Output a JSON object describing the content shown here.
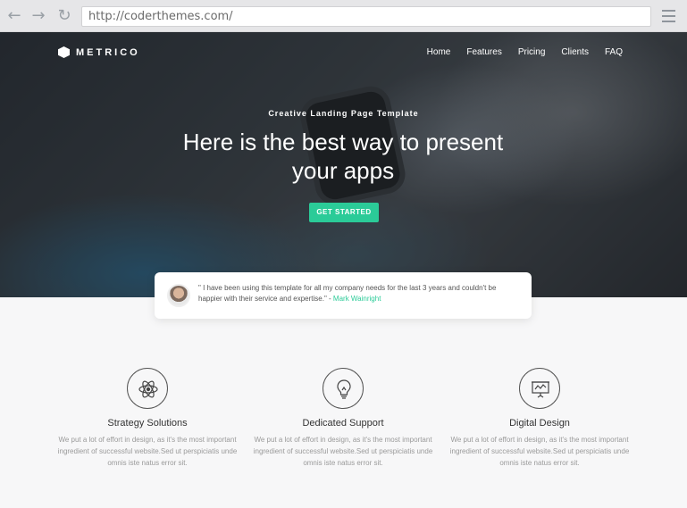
{
  "browser": {
    "url": "http://coderthemes.com/",
    "icons": [
      "back-arrow-icon",
      "forward-arrow-icon",
      "reload-icon",
      "hamburger-menu-icon"
    ]
  },
  "brand": {
    "name": "METRICO"
  },
  "nav": {
    "items": [
      "Home",
      "Features",
      "Pricing",
      "Clients",
      "FAQ"
    ]
  },
  "hero": {
    "tagline": "Creative Landing Page Template",
    "title": "Here is the best way to present your apps",
    "cta": "GET STARTED"
  },
  "testimonial": {
    "quote": "\" I have been using this template for all my company needs for the last 3 years and couldn't be happier with their service and expertise.\" - ",
    "author": "Mark Wainright"
  },
  "features": [
    {
      "icon": "atom-icon",
      "title": "Strategy Solutions",
      "desc": "We put a lot of effort in design, as it's the most important ingredient of successful website.Sed ut perspiciatis unde omnis iste natus error sit."
    },
    {
      "icon": "lightbulb-icon",
      "title": "Dedicated Support",
      "desc": "We put a lot of effort in design, as it's the most important ingredient of successful website.Sed ut perspiciatis unde omnis iste natus error sit."
    },
    {
      "icon": "presentation-board-icon",
      "title": "Digital Design",
      "desc": "We put a lot of effort in design, as it's the most important ingredient of successful website.Sed ut perspiciatis unde omnis iste natus error sit."
    }
  ],
  "colors": {
    "accent": "#2bcb98",
    "hero_overlay": "#2a3036",
    "body_bg": "#f7f7f8"
  }
}
